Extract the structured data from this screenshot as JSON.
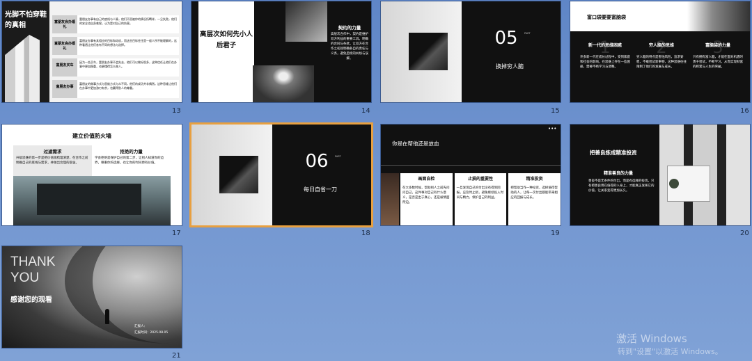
{
  "slides": [
    {
      "num": "13",
      "title": "光脚不怕穿鞋的真相",
      "rows": [
        {
          "label": "富朋友会办婚礼",
          "text": "富朋友办事有自己的底线与人脉，他们不愿被你的情况所羁绊，一旦失败，他们的安全也自身难保。认为是对自己的伤害。"
        },
        {
          "label": "富朋友会办婚礼",
          "text": "富朋友办事有其相应的目标和动机，而这些目标往往是一般人所不能理解的，这种看透让他们各有不同的想法与选择。"
        },
        {
          "label": "富朋友买车",
          "text": "因为一些买车，富朋友办事不会失去，他们可以做好很多，这种信任让他们在办事中更加稳重，也更懂得怎么做人。"
        },
        {
          "label": "富朋友办事",
          "text": "富朋友的做事方式与思维方式与众不同，他们的成功并非偶然。这种思维让他们在办事中更加游刃有余，也赢得别人的尊重。"
        }
      ]
    },
    {
      "num": "14",
      "title": "高层次如何先小人后君子",
      "side_title": "契约的力量",
      "side_text": "高层次合作中，契约是维护双方利益的重要工具。明确的合同与条款，让双方在合作之初就明确各自的责任与义务，避免后续的纠纷与误解。"
    },
    {
      "num": "15",
      "big": "05",
      "small": "PART",
      "sub": "换掉穷人脑"
    },
    {
      "num": "16",
      "title": "富口袋要要富脑袋",
      "cols": [
        {
          "n": "1",
          "h": "新一代的思维困惑",
          "text": "许多新一代在成长过程中，受到家庭和社会的影响，在思维上存在一些困惑，需要不断学习与调整。"
        },
        {
          "n": "2",
          "h": "穷人脑的思维",
          "text": "穷人脑的特点是害怕风险，追求安稳，不敢尝试新事物，这种思维往往限制了他们的发展与成长。"
        },
        {
          "n": "3",
          "h": "富脑袋的力量",
          "text": "只有拥有富人脑，才能在面对机遇时勇于尝试，不断学习，从而实现财富的积累与人生的突破。"
        }
      ]
    },
    {
      "num": "17",
      "title": "建立价值防火墙",
      "boxes": [
        {
          "h": "过滤需求",
          "text": "升级思维的第一步是把价值观梳理清楚，在合作之前明确自己的底线与需求，并做出合理的取舍。"
        },
        {
          "h": "拒绝的力量",
          "text": "学会拒绝是保护自己的第二步，让别人知道你的边界，尊重你的选择，也让你的时间更有价值。"
        }
      ]
    },
    {
      "num": "18",
      "big": "06",
      "small": "PART",
      "sub": "每日自省一刀"
    },
    {
      "num": "19",
      "title": "你是在帮他还是放血",
      "cols": [
        {
          "h": "画面自检",
          "text": "在大多数时候，帮助别人之前先问问自己，这件事对自己有什么意义，是否是出于真心，还是被情面所迫。"
        },
        {
          "h": "止损的重要性",
          "text": "一旦发现自己的付出没有得到回报，应及时止损，避免继续投入时间与精力，保护自己的利益。"
        },
        {
          "h": "精准投资",
          "text": "把帮助当作一种投资，选择值得帮助的人，让每一次付出都能带来相应的回报与成长。"
        }
      ]
    },
    {
      "num": "20",
      "title": "把善良炼成精准投资",
      "sub_h": "精准善良的力量",
      "text": "善良不是无条件的付出，而是有选择的投资。只有把善良用在值得的人身上，才能真正发挥它的价值，让关系变得更加长久。"
    },
    {
      "num": "21",
      "thank": "THANK",
      "you": "YOU",
      "msg": "感谢您的观看",
      "reporter": "汇报人：",
      "time": "汇报时间：2025.08.05"
    }
  ],
  "watermark": {
    "line1": "激活 Windows",
    "line2": "转到\"设置\"以激活 Windows。"
  }
}
